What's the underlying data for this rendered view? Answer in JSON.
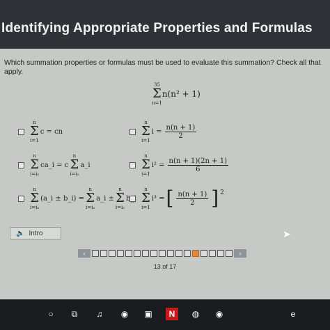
{
  "header": {
    "title": "Identifying Appropriate Properties and Formulas"
  },
  "question": {
    "text": "Which summation properties or formulas must be used to evaluate this summation? Check all that apply."
  },
  "target_sum": {
    "upper": "35",
    "lower": "n=1",
    "expr": "n(n² + 1)"
  },
  "options": [
    {
      "id": "a",
      "upper": "n",
      "lower": "i=1",
      "expr": "c = cn",
      "checked": false
    },
    {
      "id": "b",
      "upper": "n",
      "lower": "i=1",
      "expr": "i =",
      "frac_num": "n(n + 1)",
      "frac_den": "2",
      "checked": false
    },
    {
      "id": "c",
      "upper": "n",
      "lower": "i=i₀",
      "expr": "ca_i = c",
      "rhs_upper": "n",
      "rhs_lower": "i=i₀",
      "rhs_expr": "a_i",
      "checked": false
    },
    {
      "id": "d",
      "upper": "n",
      "lower": "i=1",
      "expr": "i² =",
      "frac_num": "n(n + 1)(2n + 1)",
      "frac_den": "6",
      "checked": false
    },
    {
      "id": "e",
      "upper": "n",
      "lower": "i=i₀",
      "expr": "(a_i ± b_i) =",
      "rhs1_upper": "n",
      "rhs1_lower": "i=i₀",
      "rhs1_expr": "a_i ±",
      "rhs2_upper": "n",
      "rhs2_lower": "i=i₀",
      "rhs2_expr": "b_i",
      "checked": false
    },
    {
      "id": "f",
      "upper": "n",
      "lower": "i=1",
      "expr": "i³ =",
      "frac_num": "n(n + 1)",
      "frac_den": "2",
      "power": "2",
      "checked": false
    }
  ],
  "intro_button": {
    "label": "Intro"
  },
  "pagination": {
    "current": 13,
    "total": 17,
    "label": "13 of 17",
    "prev": "‹",
    "next": "›"
  },
  "taskbar": {
    "icons": [
      "search-icon",
      "task-view-icon",
      "itunes-icon",
      "chrome-icon",
      "store-icon",
      "netflix-icon",
      "photos-icon",
      "chrome-2-icon",
      "edge-icon"
    ]
  }
}
